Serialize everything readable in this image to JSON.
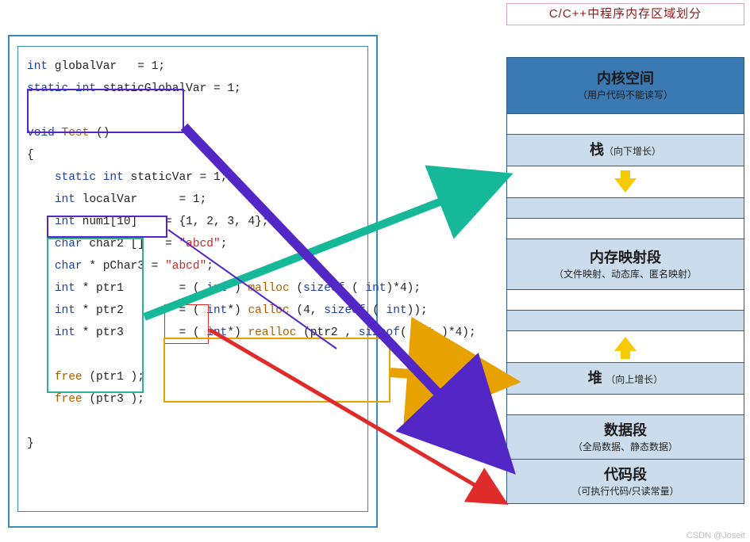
{
  "title": "C/C++中程序内存区域划分",
  "code": {
    "l1a": "int",
    "l1b": " globalVar",
    "l1c": "   = 1;",
    "l2a": "static int",
    "l2b": " staticGlobalVar",
    "l2c": " = 1;",
    "blank1": " ",
    "l3a": "void ",
    "l3b": "Test ",
    "l3c": "()",
    "l4": "{",
    "l5a": "static int",
    "l5b": " staticVar",
    "l5c": " = 1;",
    "l6a": "int",
    "l6b": " localVar",
    "l6c": "      = 1;",
    "l7a": "int",
    "l7b": " num1",
    "l7c": "[10]",
    "l7d": "    = {1, 2, 3, 4};",
    "l8a": "char",
    "l8b": " char2 []",
    "l8c": "   = ",
    "l8d": "\"abcd\"",
    "l8e": ";",
    "l9a": "char",
    "l9b": " * pChar3",
    "l9c": " = ",
    "l9d": "\"abcd\"",
    "l9e": ";",
    "l10a": "int",
    "l10b": " * ptr1",
    "l10c": "        = ( ",
    "l10d": "int",
    "l10e": "*) ",
    "l10f": "malloc ",
    "l10g": "(",
    "l10h": "sizeof ",
    "l10i": "( ",
    "l10j": "int",
    "l10k": ")*4);",
    "l11a": "int",
    "l11b": " * ptr2",
    "l11c": "        = ( ",
    "l11d": "int",
    "l11e": "*) ",
    "l11f": "calloc ",
    "l11g": "(4, ",
    "l11h": "sizeof ",
    "l11i": "( ",
    "l11j": "int",
    "l11k": "));",
    "l12a": "int",
    "l12b": " * ptr3",
    "l12c": "        = ( ",
    "l12d": "int",
    "l12e": "*) ",
    "l12f": "realloc ",
    "l12g": "(ptr2 , ",
    "l12h": "sizeof",
    "l12i": "( ",
    "l12j": "int ",
    "l12k": ")*4);",
    "blank2": " ",
    "l13a": "free ",
    "l13b": "(ptr1 );",
    "l14a": "free ",
    "l14b": "(ptr3 );",
    "blank3": " ",
    "l15": "}"
  },
  "indent1": "    ",
  "mem": {
    "kernel": {
      "title": "内核空间",
      "sub": "（用户代码不能读写）"
    },
    "stack": {
      "title": "栈",
      "note": "（向下增长）"
    },
    "mmap": {
      "title": "内存映射段",
      "sub": "（文件映射、动态库、匿名映射）"
    },
    "heap": {
      "title": "堆",
      "note": "（向上增长）"
    },
    "dataseg": {
      "title": "数据段",
      "sub": "（全局数据、静态数据）"
    },
    "codeseg": {
      "title": "代码段",
      "sub": "（可执行代码/只读常量）"
    }
  },
  "watermark": "CSDN @Joseit",
  "colors": {
    "arrow_green": "#16B89A",
    "arrow_orange": "#E8A200",
    "arrow_purple": "#5327C6",
    "arrow_red": "#E02B2B"
  }
}
